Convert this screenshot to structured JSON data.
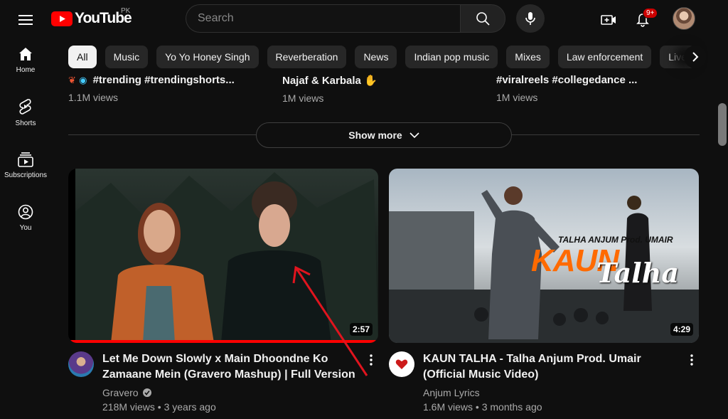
{
  "header": {
    "logo_text": "YouTube",
    "region": "PK",
    "search_placeholder": "Search",
    "notifications_badge": "9+"
  },
  "sidebar": {
    "items": [
      {
        "label": "Home",
        "icon": "home-icon"
      },
      {
        "label": "Shorts",
        "icon": "shorts-icon"
      },
      {
        "label": "Subscriptions",
        "icon": "subscriptions-icon"
      },
      {
        "label": "You",
        "icon": "you-icon"
      }
    ]
  },
  "chips": [
    "All",
    "Music",
    "Yo Yo Honey Singh",
    "Reverberation",
    "News",
    "Indian pop music",
    "Mixes",
    "Law enforcement",
    "Live"
  ],
  "shorts": [
    {
      "title": "#trending #trendingshorts...",
      "views": "1.1M views"
    },
    {
      "title": "Najaf & Karbala",
      "views": "1M views"
    },
    {
      "title": "#viralreels #collegedance ...",
      "views": "1M views"
    }
  ],
  "show_more": "Show more",
  "videos": [
    {
      "title": "Let Me Down Slowly x Main Dhoondne Ko Zamaane Mein (Gravero Mashup) | Full Version",
      "channel": "Gravero",
      "stats": "218M views • 3 years ago",
      "duration": "2:57",
      "progress": 1.0,
      "verified": true
    },
    {
      "title": "KAUN TALHA - Talha Anjum Prod. Umair (Official Music Video)",
      "channel": "Anjum Lyrics",
      "stats": "1.6M views • 3 months ago",
      "duration": "4:29",
      "thumb_text_top": "TALHA ANJUM Prod. UMAIR",
      "thumb_text_big": "KAUN",
      "thumb_text_script": "Talha"
    }
  ],
  "colors": {
    "accent": "#ff0000",
    "background": "#0f0f0f",
    "chip": "#272727"
  }
}
